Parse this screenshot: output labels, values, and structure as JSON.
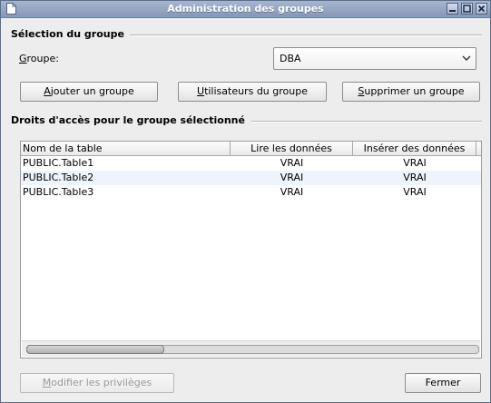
{
  "window": {
    "title": "Administration des groupes"
  },
  "group_section": {
    "title": "Sélection du groupe",
    "group_label_mnemonic": "G",
    "group_label_rest": "roupe:",
    "selected_group": "DBA",
    "buttons": {
      "add_mnemonic": "A",
      "add_rest": "jouter un groupe",
      "users_mnemonic": "U",
      "users_rest": "tilisateurs du groupe",
      "delete_mnemonic": "S",
      "delete_rest": "upprimer un groupe"
    }
  },
  "rights_section": {
    "title": "Droits d'accès pour le groupe sélectionné",
    "columns": [
      "Nom de la table",
      "Lire les données",
      "Insérer des données"
    ],
    "rows": [
      {
        "table": "PUBLIC.Table1",
        "read": "VRAI",
        "insert": "VRAI"
      },
      {
        "table": "PUBLIC.Table2",
        "read": "VRAI",
        "insert": "VRAI"
      },
      {
        "table": "PUBLIC.Table3",
        "read": "VRAI",
        "insert": "VRAI"
      }
    ]
  },
  "footer": {
    "modify_mnemonic": "M",
    "modify_rest": "odifier les privilèges",
    "close_label": "Fermer"
  }
}
